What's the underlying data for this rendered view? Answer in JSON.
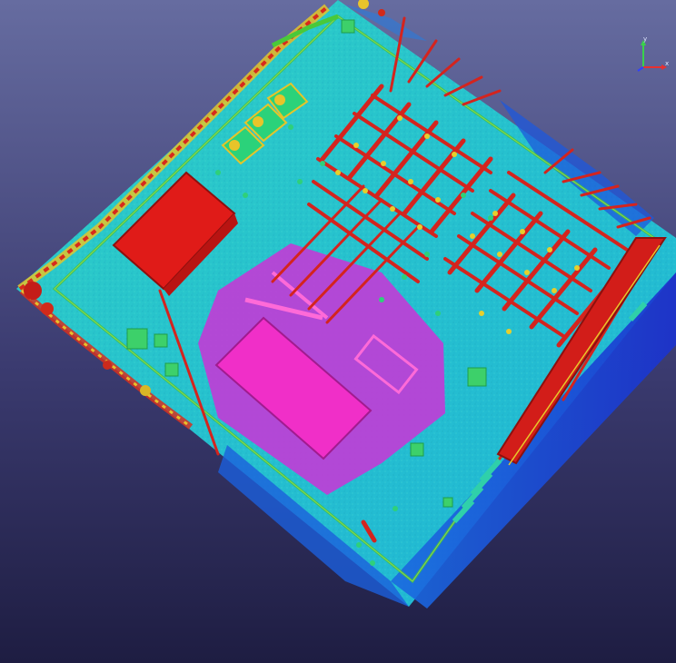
{
  "viewer": {
    "axis_gizmo": {
      "y_label": "y",
      "x_label": "x",
      "colors": {
        "y": "#39d24a",
        "x": "#e83030",
        "z": "#3040ff"
      }
    },
    "colors": {
      "background_top": "#656b9f",
      "background_bottom": "#1e1d42",
      "ground": "#27c6c9",
      "highlight_region": "#c23bd6",
      "transformer_body": "#ee2fc6",
      "structures": "#d4241e",
      "vegetation_edge": "#e8d52a",
      "low_ground": "#1847d6"
    }
  }
}
